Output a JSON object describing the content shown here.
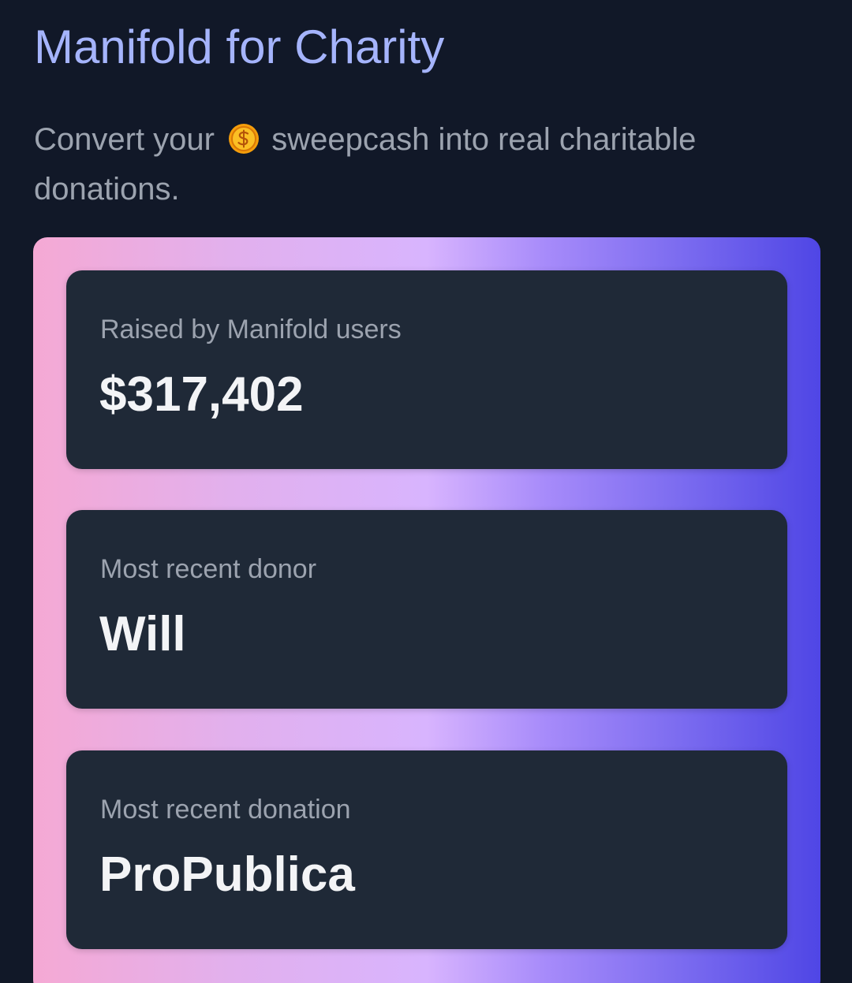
{
  "header": {
    "title": "Manifold for Charity",
    "subtitle_before": "Convert your",
    "subtitle_after": "sweepcash into real charitable donations.",
    "coin_icon": "sweepcash-coin-icon"
  },
  "stats": [
    {
      "label": "Raised by Manifold users",
      "value": "$317,402"
    },
    {
      "label": "Most recent donor",
      "value": "Will"
    },
    {
      "label": "Most recent donation",
      "value": "ProPublica"
    }
  ],
  "colors": {
    "background": "#111828",
    "title": "#a5b4fc",
    "card": "#1f2937",
    "gradient_start": "#f5a9d4",
    "gradient_mid": "#d8b4fe",
    "gradient_end": "#4f46e5",
    "coin": "#f59e0b"
  }
}
